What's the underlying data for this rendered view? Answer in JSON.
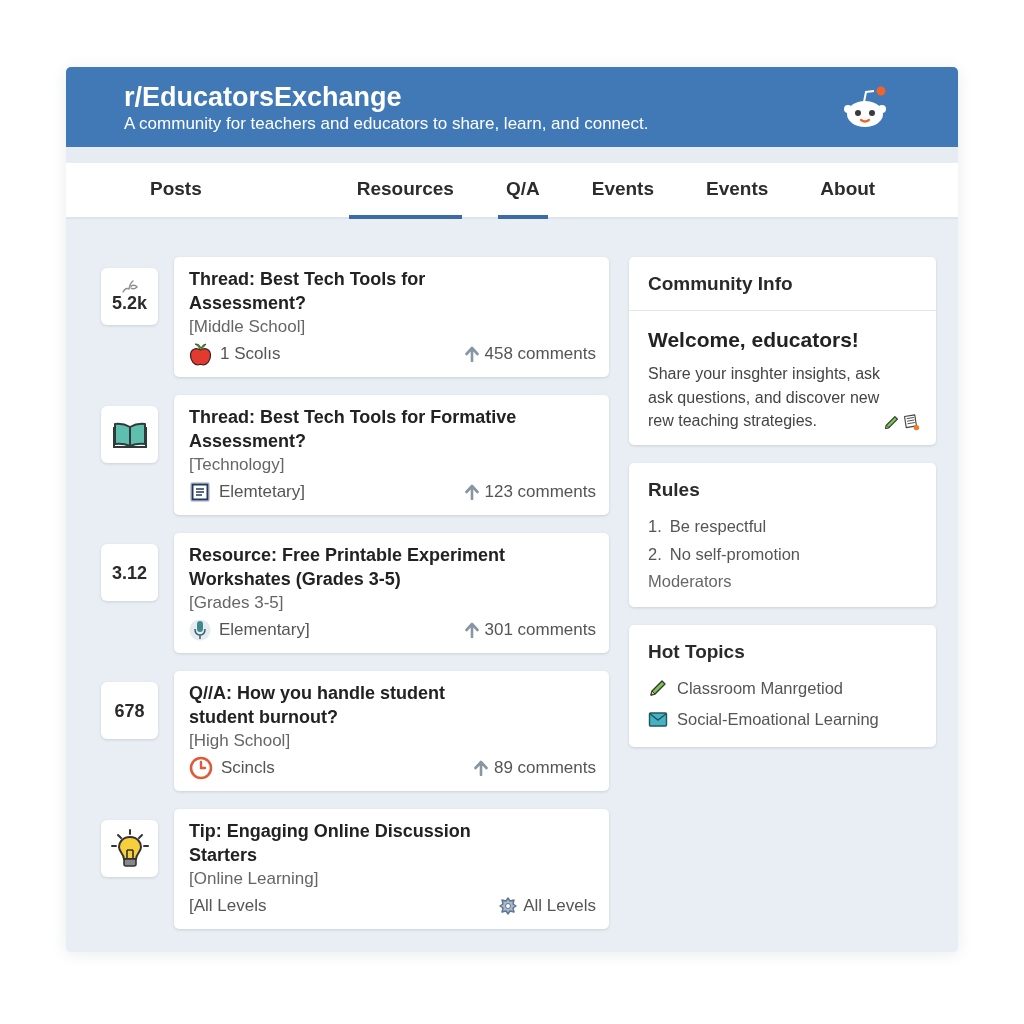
{
  "header": {
    "title": "r/EducatorsExchange",
    "subtitle": "A community for teachers and educators to share, learn, and connect."
  },
  "tabs": [
    {
      "label": "Posts",
      "selected": false
    },
    {
      "label": "Resources",
      "selected": true
    },
    {
      "label": "Q/A",
      "selected": true
    },
    {
      "label": "Events",
      "selected": false
    },
    {
      "label": "Events",
      "selected": false
    },
    {
      "label": "About",
      "selected": false
    }
  ],
  "posts": [
    {
      "side": {
        "kind": "count",
        "count": "5.2k"
      },
      "title_lines": [
        "Thread: Best Tech Tools for",
        "Assessment?"
      ],
      "tag": "[Middle School]",
      "meta": "1 Scolıs",
      "stat": {
        "kind": "comments",
        "text": "458 comments"
      }
    },
    {
      "side": {
        "kind": "icon"
      },
      "title_lines": [
        "Thread: Best Tech Tools for Formative",
        "Assessment?"
      ],
      "tag": "[Technology]",
      "meta": "Elemtetary]",
      "stat": {
        "kind": "comments",
        "text": "123 comments"
      }
    },
    {
      "side": {
        "kind": "count",
        "count": "3.12"
      },
      "title_lines": [
        "Resource: Free Printable Experiment",
        "Workshates (Grades 3-5)"
      ],
      "tag": "[Grades 3-5]",
      "meta": "Elementary]",
      "stat": {
        "kind": "comments",
        "text": "301 comments"
      }
    },
    {
      "side": {
        "kind": "count",
        "count": "678"
      },
      "title_lines": [
        "Q//A: How you handle student",
        "student burnout?"
      ],
      "tag": "[High School]",
      "meta": "Scincls",
      "stat": {
        "kind": "comments",
        "text": "89 comments"
      }
    },
    {
      "side": {
        "kind": "icon"
      },
      "title_lines": [
        "Tip: Engaging Online Discussion",
        "Starters"
      ],
      "tag": "[Online Learning]",
      "meta": "[All Levels",
      "stat": {
        "kind": "levels",
        "text": "All Levels"
      }
    }
  ],
  "sidebar": {
    "community_info": {
      "title": "Community Info",
      "heading": "Welcome, educators!",
      "text_lines": [
        "Share your insghter insights, ask",
        "ask questions, and discover new",
        "rew teaching strategies."
      ]
    },
    "rules": {
      "title": "Rules",
      "items": [
        {
          "number": "1.",
          "text": "Be respectful"
        },
        {
          "number": "2.",
          "text": "No self-promotion"
        }
      ],
      "footer": "Moderators"
    },
    "hot_topics": {
      "title": "Hot Topics",
      "items": [
        "Classroom Manrgetiod",
        "Social-Emoational Learning"
      ]
    }
  }
}
